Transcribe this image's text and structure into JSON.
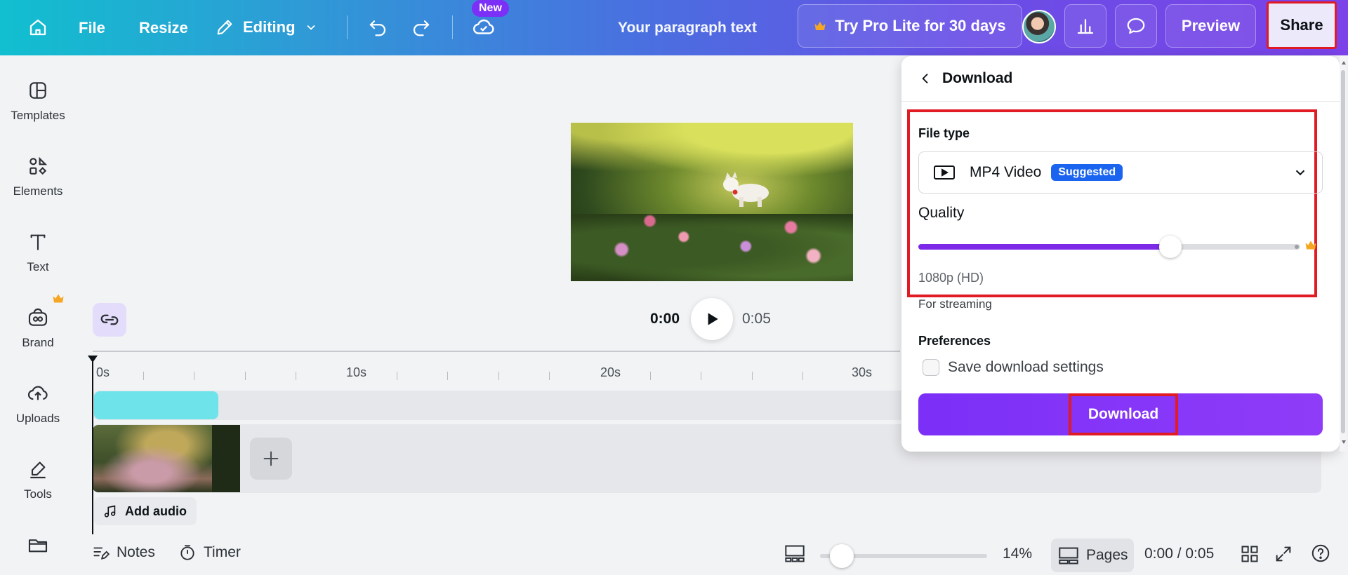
{
  "topbar": {
    "file_label": "File",
    "resize_label": "Resize",
    "editing_label": "Editing",
    "new_badge": "New",
    "doc_title": "Your paragraph text",
    "pro_label": "Try Pro Lite for 30 days",
    "preview_label": "Preview",
    "share_label": "Share"
  },
  "sidebar": {
    "items": [
      {
        "label": "Templates",
        "icon": "templates-icon"
      },
      {
        "label": "Elements",
        "icon": "elements-icon"
      },
      {
        "label": "Text",
        "icon": "text-icon"
      },
      {
        "label": "Brand",
        "icon": "brand-icon"
      },
      {
        "label": "Uploads",
        "icon": "uploads-icon"
      },
      {
        "label": "Tools",
        "icon": "tools-icon"
      },
      {
        "label": "",
        "icon": "projects-icon"
      }
    ]
  },
  "player": {
    "current_time": "0:00",
    "total_time": "0:05"
  },
  "timeline": {
    "labels": [
      "0s",
      "10s",
      "20s",
      "30s"
    ],
    "add_audio_label": "Add audio"
  },
  "bottombar": {
    "notes_label": "Notes",
    "timer_label": "Timer",
    "zoom_percent": "14%",
    "zoom_level": 0.14,
    "pages_label": "Pages",
    "page_time": "0:00 / 0:05"
  },
  "download_panel": {
    "title": "Download",
    "file_type_label": "File type",
    "file_type_value": "MP4 Video",
    "suggested_badge": "Suggested",
    "quality_label": "Quality",
    "quality_fraction": 0.66,
    "quality_value": "1080p (HD)",
    "quality_note": "For streaming",
    "preferences_label": "Preferences",
    "save_settings_label": "Save download settings",
    "download_button": "Download"
  },
  "colors": {
    "accent_purple": "#7d2ae8",
    "highlight_red": "#e01b24",
    "suggested_blue": "#1a64f0",
    "crown_gold": "#f5a623"
  }
}
